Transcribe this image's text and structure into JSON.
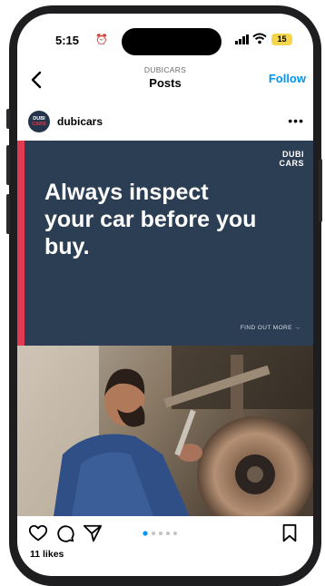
{
  "status_bar": {
    "time": "5:15",
    "battery": "15"
  },
  "nav": {
    "account": "DUBICARS",
    "title": "Posts",
    "follow_label": "Follow"
  },
  "post": {
    "avatar_text_top": "DUBI",
    "avatar_text_bottom": "CARS",
    "username": "dubicars",
    "banner": {
      "brand_top": "DUBI",
      "brand_bottom": "CARS",
      "headline": "Always inspect your car before you buy.",
      "cta": "FIND OUT MORE →",
      "accent_color": "#e23a50",
      "background_color": "#2c3e54"
    },
    "carousel": {
      "total": 5,
      "active": 0
    },
    "likes": "11 likes"
  },
  "icons": [
    "back-icon",
    "more-icon",
    "heart-icon",
    "comment-icon",
    "share-icon",
    "bookmark-icon"
  ],
  "colors": {
    "follow": "#0095f6",
    "battery": "#f5d64a"
  }
}
